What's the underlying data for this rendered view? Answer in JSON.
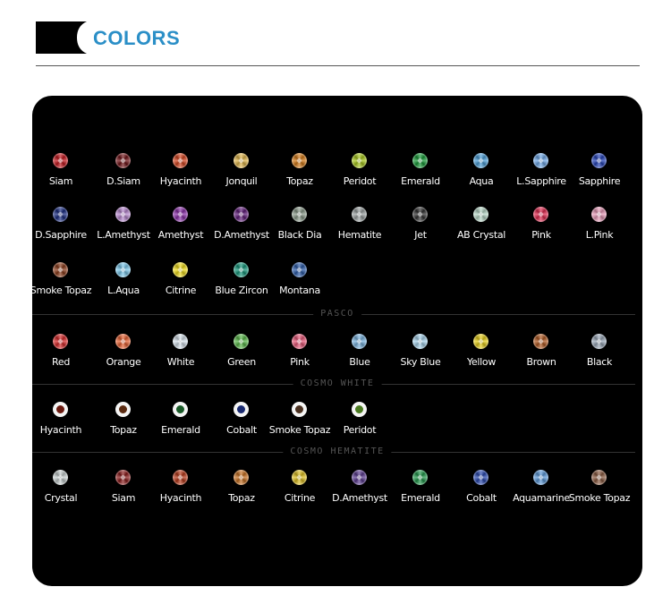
{
  "header": {
    "title": "COLORS"
  },
  "colors": {
    "accent": "#2b8fc7",
    "block": "#000000",
    "panel": "#000000"
  },
  "sections": [
    {
      "label": "",
      "rows": [
        [
          {
            "name": "Siam",
            "color": "#c4161c"
          },
          {
            "name": "D.Siam",
            "color": "#6e1014"
          },
          {
            "name": "Hyacinth",
            "color": "#d5441e"
          },
          {
            "name": "Jonquil",
            "color": "#e1b64a"
          },
          {
            "name": "Topaz",
            "color": "#d57a16"
          },
          {
            "name": "Peridot",
            "color": "#a8c81a"
          },
          {
            "name": "Emerald",
            "color": "#169a36"
          },
          {
            "name": "Aqua",
            "color": "#4a9ed8"
          },
          {
            "name": "L.Sapphire",
            "color": "#6ea8e8"
          },
          {
            "name": "Sapphire",
            "color": "#2342b8"
          }
        ],
        [
          {
            "name": "D.Sapphire",
            "color": "#182a80"
          },
          {
            "name": "L.Amethyst",
            "color": "#b888d0"
          },
          {
            "name": "Amethyst",
            "color": "#8a2ea8"
          },
          {
            "name": "D.Amethyst",
            "color": "#5e1a78"
          },
          {
            "name": "Black Dia",
            "color": "#8a9a8a"
          },
          {
            "name": "Hematite",
            "color": "#9aa0a0"
          },
          {
            "name": "Jet",
            "color": "#303030"
          },
          {
            "name": "AB Crystal",
            "color": "#b8d8c8"
          },
          {
            "name": "Pink",
            "color": "#e0284e"
          },
          {
            "name": "L.Pink",
            "color": "#e89ab8"
          }
        ],
        [
          {
            "name": "Smoke Topaz",
            "color": "#8a3a18"
          },
          {
            "name": "L.Aqua",
            "color": "#7ccaee"
          },
          {
            "name": "Citrine",
            "color": "#f2de1a"
          },
          {
            "name": "Blue Zircon",
            "color": "#14967a"
          },
          {
            "name": "Montana",
            "color": "#2a5aa8"
          }
        ]
      ]
    },
    {
      "label": "PASCO",
      "rows": [
        [
          {
            "name": "Red",
            "color": "#d82828"
          },
          {
            "name": "Orange",
            "color": "#e86030"
          },
          {
            "name": "White",
            "color": "#d8e4ee"
          },
          {
            "name": "Green",
            "color": "#58b848"
          },
          {
            "name": "Pink",
            "color": "#e85878"
          },
          {
            "name": "Blue",
            "color": "#7ab4e0"
          },
          {
            "name": "Sky Blue",
            "color": "#a8d4ee"
          },
          {
            "name": "Yellow",
            "color": "#e8d018"
          },
          {
            "name": "Brown",
            "color": "#b05820"
          },
          {
            "name": "Black",
            "color": "#9aa8b8"
          }
        ]
      ]
    },
    {
      "label": "COSMO WHITE",
      "rows": [
        [
          {
            "name": "Hyacinth",
            "color": "#6a1a10"
          },
          {
            "name": "Topaz",
            "color": "#5a2a10"
          },
          {
            "name": "Emerald",
            "color": "#1a5a28"
          },
          {
            "name": "Cobalt",
            "color": "#1a2a70"
          },
          {
            "name": "Smoke Topaz",
            "color": "#4a3020"
          },
          {
            "name": "Peridot",
            "color": "#4a7a20"
          }
        ]
      ]
    },
    {
      "label": "COSMO HEMATITE",
      "rows": [
        [
          {
            "name": "Crystal",
            "color": "#c8d0d0"
          },
          {
            "name": "Siam",
            "color": "#8a1a1a"
          },
          {
            "name": "Hyacinth",
            "color": "#b83818"
          },
          {
            "name": "Topaz",
            "color": "#c87020"
          },
          {
            "name": "Citrine",
            "color": "#e0c020"
          },
          {
            "name": "D.Amethyst",
            "color": "#5a3a90"
          },
          {
            "name": "Emerald",
            "color": "#20984a"
          },
          {
            "name": "Cobalt",
            "color": "#2848b0"
          },
          {
            "name": "Aquamarine",
            "color": "#5a98d8"
          },
          {
            "name": "Smoke Topaz",
            "color": "#8a5a40"
          }
        ]
      ]
    }
  ]
}
